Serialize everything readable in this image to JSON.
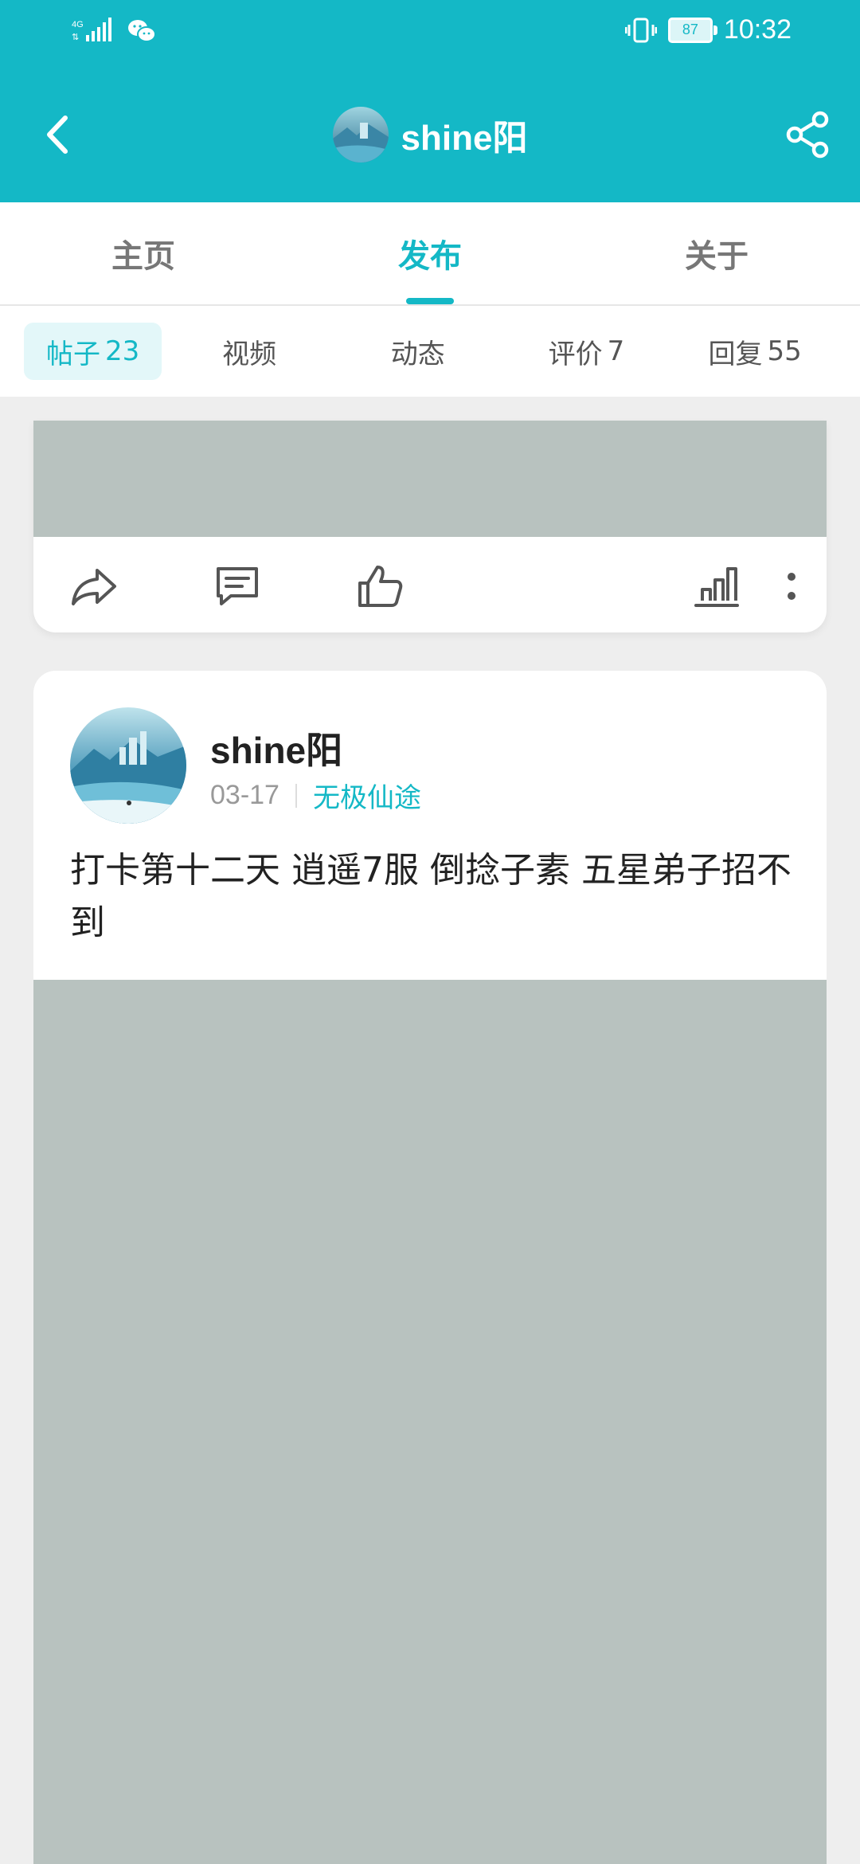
{
  "status_bar": {
    "signal_label": "4G",
    "battery": "87",
    "time": "10:32"
  },
  "header": {
    "title": "shine阳"
  },
  "main_tabs": [
    {
      "label": "主页"
    },
    {
      "label": "发布"
    },
    {
      "label": "关于"
    }
  ],
  "sub_tabs": [
    {
      "label": "帖子",
      "count": "23"
    },
    {
      "label": "视频",
      "count": ""
    },
    {
      "label": "动态",
      "count": ""
    },
    {
      "label": "评价",
      "count": "7"
    },
    {
      "label": "回复",
      "count": "55"
    }
  ],
  "post": {
    "author": "shine阳",
    "date": "03-17",
    "game": "无极仙途",
    "text": "打卡第十二天 逍遥7服 倒捻子素 五星弟子招不到"
  },
  "icons": {
    "back": "chevron-left-icon",
    "share": "share-icon",
    "forward": "forward-icon",
    "comment": "comment-icon",
    "like": "thumbs-up-icon",
    "stats": "bar-chart-icon",
    "more": "more-vertical-icon"
  },
  "colors": {
    "accent": "#14b8c6",
    "image_placeholder": "#b8c2bf"
  }
}
